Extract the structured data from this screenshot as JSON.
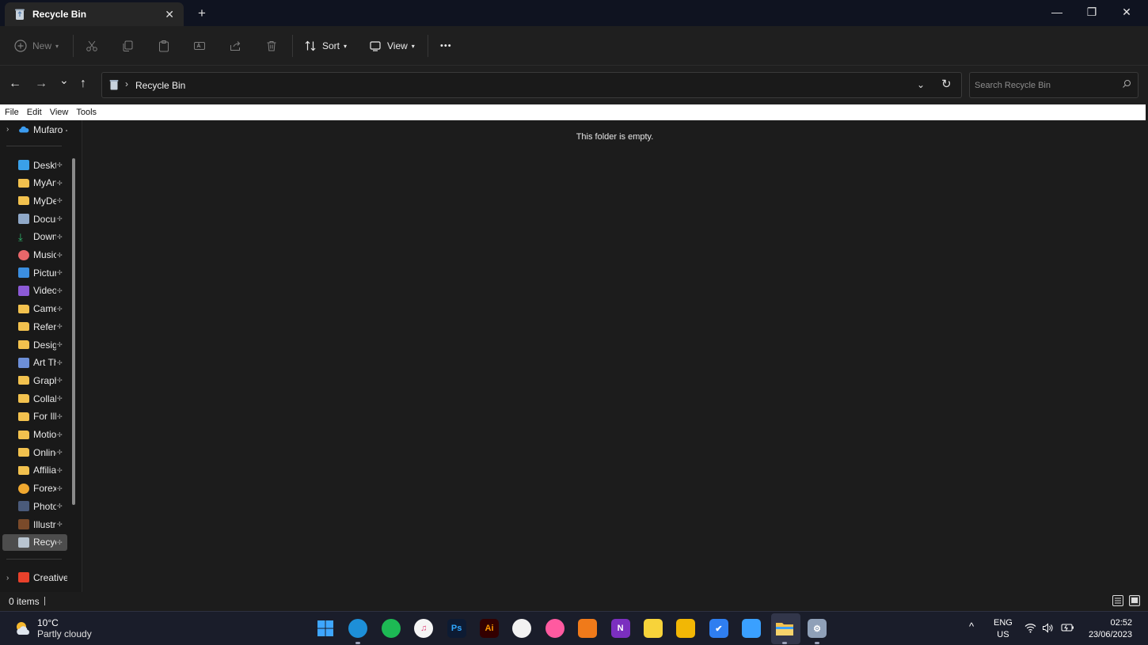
{
  "window": {
    "tab_title": "Recycle Bin",
    "tab_close": "✕",
    "new_tab": "+",
    "minimize": "—",
    "restore": "❐",
    "close": "✕"
  },
  "toolbar": {
    "new_label": "New",
    "sort_label": "Sort",
    "view_label": "View",
    "more_label": "•••"
  },
  "nav": {
    "back": "←",
    "forward": "→",
    "recent": "⌄",
    "up": "↑"
  },
  "address": {
    "path": "Recycle Bin",
    "separator": "›"
  },
  "search": {
    "placeholder": "Search Recycle Bin"
  },
  "menubar": {
    "items": [
      "File",
      "Edit",
      "View",
      "Tools"
    ]
  },
  "sidebar": {
    "onedrive": {
      "label": "Mufaro -"
    },
    "items": [
      {
        "label": "Desktop",
        "icon": "desktop-icon",
        "color": "#3aa0e8"
      },
      {
        "label": "MyArt",
        "icon": "folder-icon",
        "color": "#f2c14e"
      },
      {
        "label": "MyDesigns",
        "icon": "folder-icon",
        "color": "#f2c14e"
      },
      {
        "label": "Documents",
        "icon": "documents-icon",
        "color": "#8fa8c8"
      },
      {
        "label": "Downloads",
        "icon": "downloads-icon",
        "color": "#2fbf71"
      },
      {
        "label": "Music",
        "icon": "music-icon",
        "color": "#e8676a"
      },
      {
        "label": "Pictures",
        "icon": "pictures-icon",
        "color": "#3b8ee0"
      },
      {
        "label": "Videos",
        "icon": "videos-icon",
        "color": "#8c5ad6"
      },
      {
        "label": "Camera",
        "icon": "camera-folder-icon",
        "color": "#f2c14e"
      },
      {
        "label": "References",
        "icon": "folder-icon",
        "color": "#f2c14e"
      },
      {
        "label": "Design",
        "icon": "folder-icon",
        "color": "#f2c14e"
      },
      {
        "label": "Art Things",
        "icon": "image-folder-icon",
        "color": "#6d8fd8"
      },
      {
        "label": "Graphics",
        "icon": "folder-icon",
        "color": "#f2c14e"
      },
      {
        "label": "Collabs",
        "icon": "folder-icon",
        "color": "#f2c14e"
      },
      {
        "label": "For Illustration",
        "icon": "folder-icon",
        "color": "#f2c14e"
      },
      {
        "label": "Motion",
        "icon": "folder-icon",
        "color": "#f2c14e"
      },
      {
        "label": "Online",
        "icon": "folder-icon",
        "color": "#f2c14e"
      },
      {
        "label": "Affiliates",
        "icon": "folder-icon",
        "color": "#f2c14e"
      },
      {
        "label": "Forex",
        "icon": "forex-icon",
        "color": "#f0a830"
      },
      {
        "label": "Photoshop",
        "icon": "photoshop-file-icon",
        "color": "#4a5a7a"
      },
      {
        "label": "Illustrator",
        "icon": "illustrator-file-icon",
        "color": "#7a4a2a"
      },
      {
        "label": "Recycle Bin",
        "icon": "recycle-bin-icon",
        "color": "#b8c4d0"
      }
    ],
    "pin_glyph": "📌",
    "creative": {
      "label": "Creative"
    }
  },
  "main": {
    "empty_message": "This folder is empty."
  },
  "status": {
    "item_count": "0 items"
  },
  "taskbar": {
    "weather_temp": "10°C",
    "weather_condition": "Partly cloudy",
    "apps": [
      {
        "name": "start",
        "label": "",
        "color": "#3ea6ff"
      },
      {
        "name": "edge",
        "label": "",
        "color": "#1d8fd8"
      },
      {
        "name": "spotify",
        "label": "",
        "color": "#1db954"
      },
      {
        "name": "itunes",
        "label": "♫",
        "color": "#f5f5f5"
      },
      {
        "name": "photoshop",
        "label": "Ps",
        "color": "#0d1b33"
      },
      {
        "name": "illustrator",
        "label": "Ai",
        "color": "#330000"
      },
      {
        "name": "clip-studio",
        "label": "",
        "color": "#f2f2f2"
      },
      {
        "name": "color-app",
        "label": "",
        "color": "#ff5aa0"
      },
      {
        "name": "blender",
        "label": "",
        "color": "#f07a1a"
      },
      {
        "name": "onenote",
        "label": "N",
        "color": "#7b2fbf"
      },
      {
        "name": "sticky-notes",
        "label": "",
        "color": "#f7d33a"
      },
      {
        "name": "store",
        "label": "",
        "color": "#f2b705"
      },
      {
        "name": "todo",
        "label": "✔",
        "color": "#2f7ef0"
      },
      {
        "name": "calendar",
        "label": "",
        "color": "#3aa0ff"
      },
      {
        "name": "file-explorer",
        "label": "",
        "color": "#f2c14e"
      },
      {
        "name": "settings",
        "label": "⚙",
        "color": "#8fa0b8"
      }
    ],
    "lang_top": "ENG",
    "lang_bottom": "US",
    "time": "02:52",
    "date": "23/06/2023"
  }
}
